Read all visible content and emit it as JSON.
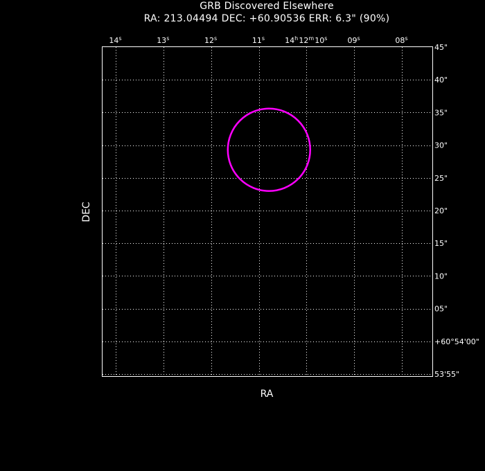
{
  "header": {
    "title": "GRB Discovered Elsewhere",
    "subtitle": "RA: 213.04494  DEC: +60.90536  ERR: 6.3\" (90%)"
  },
  "chart_data": {
    "type": "scatter",
    "title": "GRB Discovered Elsewhere",
    "subtitle": "RA: 213.04494  DEC: +60.90536  ERR: 6.3\" (90%)",
    "xlabel": "RA",
    "ylabel": "DEC",
    "grid": true,
    "xlim_sec": [
      14.85,
      7.5
    ],
    "ylim_arcsec": [
      54.5,
      95.0
    ],
    "x_ticks": [
      {
        "value": 14,
        "main": "14",
        "sup": "s"
      },
      {
        "value": 13,
        "main": "13",
        "sup": "s"
      },
      {
        "value": 12,
        "main": "12",
        "sup": "s"
      },
      {
        "value": 11,
        "main": "11",
        "sup": "s"
      },
      {
        "value": 10,
        "main": "14",
        "sup": "h",
        "main2": "12",
        "sup2": "m",
        "main3": "10",
        "sup3": "s"
      },
      {
        "value": 9,
        "main": "09",
        "sup": "s"
      },
      {
        "value": 8,
        "main": "08",
        "sup": "s"
      }
    ],
    "y_ticks": [
      {
        "value": 95,
        "label": "45\""
      },
      {
        "value": 90,
        "label": "40\""
      },
      {
        "value": 85,
        "label": "35\""
      },
      {
        "value": 80,
        "label": "30\""
      },
      {
        "value": 75,
        "label": "25\""
      },
      {
        "value": 70,
        "label": "20\""
      },
      {
        "value": 65,
        "label": "15\""
      },
      {
        "value": 60,
        "label": "10\""
      },
      {
        "value": 55,
        "label": "05\""
      },
      {
        "value": 50,
        "label": "+60°54'00\""
      },
      {
        "value": 45,
        "label": "53'55\""
      }
    ],
    "error_circle": {
      "ra_deg": 213.04494,
      "dec_deg": 60.90536,
      "radius_arcsec": 6.3,
      "color": "#ff00ff"
    }
  }
}
